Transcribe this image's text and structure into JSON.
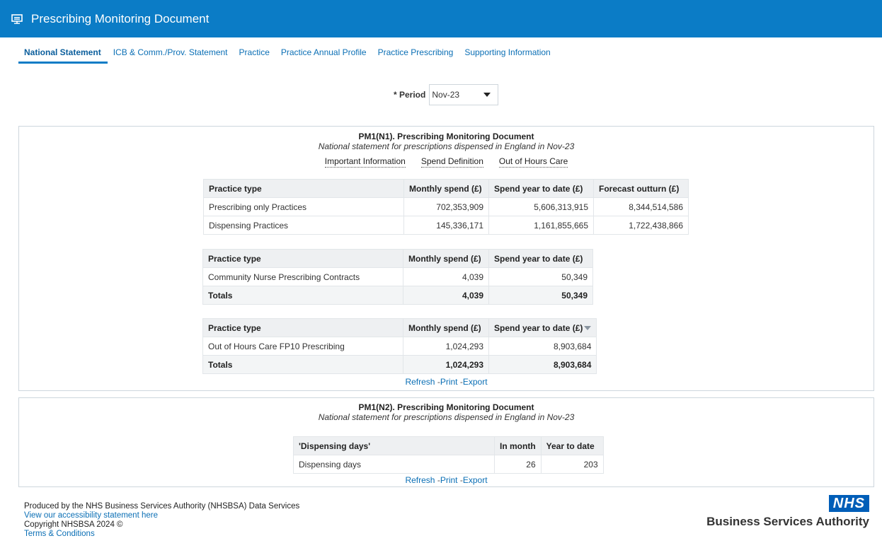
{
  "app": {
    "title": "Prescribing Monitoring Document",
    "icon": "presentation-icon"
  },
  "tabs": [
    {
      "label": "National Statement",
      "active": true
    },
    {
      "label": "ICB & Comm./Prov. Statement"
    },
    {
      "label": "Practice"
    },
    {
      "label": "Practice Annual Profile"
    },
    {
      "label": "Practice Prescribing"
    },
    {
      "label": "Supporting Information"
    }
  ],
  "period": {
    "label": "* Period",
    "value": "Nov-23"
  },
  "report1": {
    "title": "PM1(N1). Prescribing Monitoring Document",
    "subtitle": "National statement for prescriptions dispensed in England in Nov-23",
    "links": [
      "Important Information",
      "Spend Definition",
      "Out of Hours Care"
    ],
    "table1": {
      "headers": [
        "Practice type",
        "Monthly spend (£)",
        "Spend year to date (£)",
        "Forecast outturn (£)"
      ],
      "rows": [
        [
          "Prescribing only Practices",
          "702,353,909",
          "5,606,313,915",
          "8,344,514,586"
        ],
        [
          "Dispensing Practices",
          "145,336,171",
          "1,161,855,665",
          "1,722,438,866"
        ]
      ]
    },
    "table2": {
      "headers": [
        "Practice type",
        "Monthly spend (£)",
        "Spend year to date (£)"
      ],
      "rows": [
        [
          "Community Nurse Prescribing Contracts",
          "4,039",
          "50,349"
        ]
      ],
      "totals": [
        "Totals",
        "4,039",
        "50,349"
      ]
    },
    "table3": {
      "headers": [
        "Practice type",
        "Monthly spend (£)",
        "Spend year to date (£)"
      ],
      "rows": [
        [
          "Out of Hours Care FP10 Prescribing",
          "1,024,293",
          "8,903,684"
        ]
      ],
      "totals": [
        "Totals",
        "1,024,293",
        "8,903,684"
      ]
    },
    "actions": {
      "refresh": "Refresh",
      "print": "Print",
      "export": "Export",
      "sep": "-"
    }
  },
  "report2": {
    "title": "PM1(N2). Prescribing Monitoring Document",
    "subtitle": "National statement for prescriptions dispensed in England in Nov-23",
    "table": {
      "headers": [
        "'Dispensing days'",
        "In month",
        "Year to date"
      ],
      "rows": [
        [
          "Dispensing days",
          "26",
          "203"
        ]
      ]
    },
    "actions": {
      "refresh": "Refresh",
      "print": "Print",
      "export": "Export",
      "sep": "-"
    }
  },
  "footer": {
    "produced": "Produced by the NHS Business Services Authority (NHSBSA) Data Services",
    "accessibility": "View our accessibility statement here",
    "copyright": "Copyright NHSBSA 2024 ©",
    "terms": "Terms & Conditions"
  },
  "logo": {
    "mark": "NHS",
    "org": "Business Services Authority"
  },
  "colors": {
    "brand": "#0b7cc6",
    "nhs_blue": "#005eb8",
    "link": "#0b6fb5"
  }
}
